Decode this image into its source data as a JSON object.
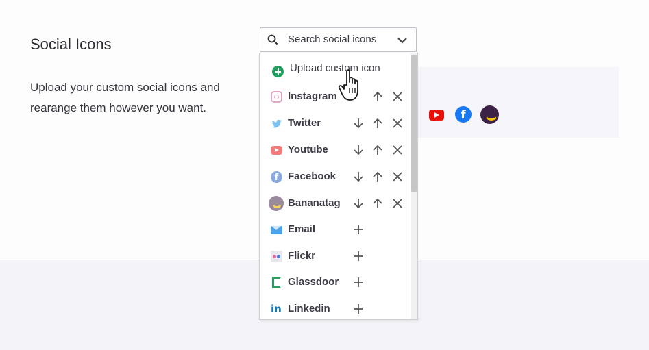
{
  "section": {
    "title": "Social Icons",
    "description": "Upload your custom social icons and rearange them however you want."
  },
  "search": {
    "placeholder": "Search social icons",
    "value": ""
  },
  "dropdown": {
    "upload_label": "Upload custom icon",
    "selected_items": [
      {
        "label": "Instagram",
        "icon": "instagram-icon"
      },
      {
        "label": "Twitter",
        "icon": "twitter-icon"
      },
      {
        "label": "Youtube",
        "icon": "youtube-icon"
      },
      {
        "label": "Facebook",
        "icon": "facebook-icon"
      },
      {
        "label": "Bananatag",
        "icon": "bananatag-icon"
      }
    ],
    "available_items": [
      {
        "label": "Email",
        "icon": "email-icon"
      },
      {
        "label": "Flickr",
        "icon": "flickr-icon"
      },
      {
        "label": "Glassdoor",
        "icon": "glassdoor-icon"
      },
      {
        "label": "Linkedin",
        "icon": "linkedin-icon"
      }
    ]
  },
  "preview": {
    "icons": [
      "youtube-icon",
      "facebook-icon",
      "bananatag-icon"
    ]
  },
  "glyphs": {
    "facebook": "f",
    "linkedin": "in"
  },
  "colors": {
    "upload_green": "#1f9e5e",
    "youtube_red": "#e8150d",
    "facebook_blue": "#1877f2",
    "bananatag_purple": "#3b2246"
  }
}
